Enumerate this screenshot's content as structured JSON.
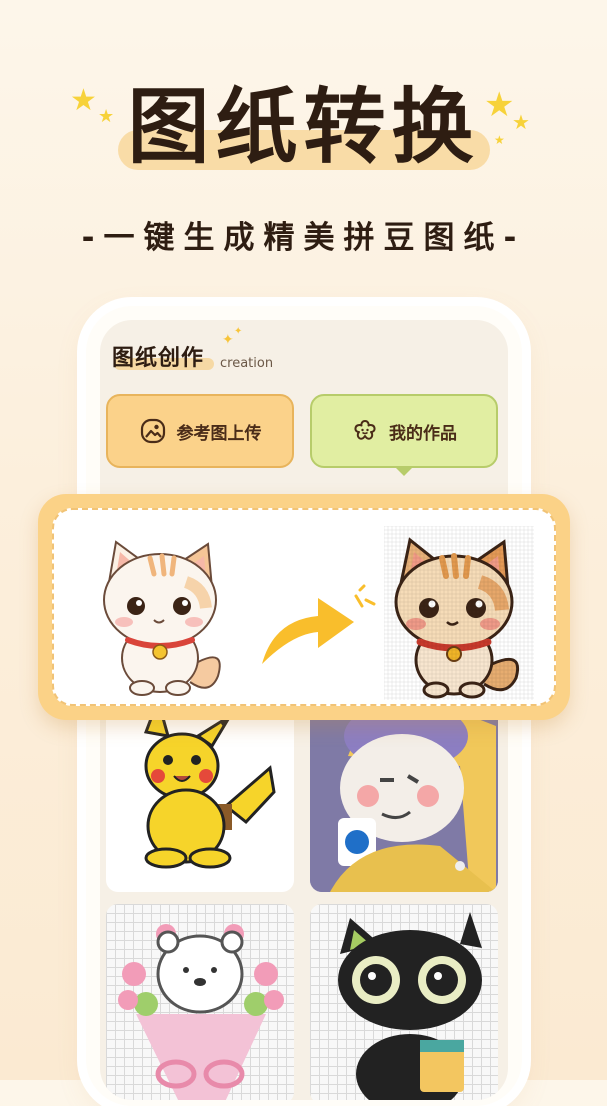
{
  "header": {
    "title": "图纸转换",
    "subtitle": "-一键生成精美拼豆图纸-"
  },
  "panel": {
    "title": "图纸创作",
    "title_en": "creation",
    "upload_button": {
      "label": "参考图上传",
      "icon": "image-upload-icon"
    },
    "works_button": {
      "label": "我的作品",
      "icon": "flower-icon"
    }
  },
  "colors": {
    "title_text": "#2e1d12",
    "title_highlight": "#f9dca7",
    "star": "#f7d23a",
    "upload_button_bg": "#fbd28a",
    "works_button_bg": "#e1eea2",
    "comparison_frame": "#fbd287",
    "arrow": "#f9be2c"
  },
  "gallery": [
    {
      "name": "pikachu-pattern"
    },
    {
      "name": "girl-with-pearl-earring-pattern"
    },
    {
      "name": "bear-bouquet-pattern"
    },
    {
      "name": "black-cat-pattern"
    }
  ],
  "comparison": {
    "before": "cat-illustration",
    "after": "cat-bead-pattern",
    "arrow": "arrow-right-icon"
  }
}
